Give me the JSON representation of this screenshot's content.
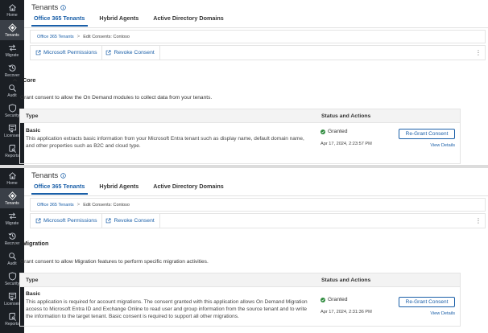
{
  "sidebar": {
    "items": [
      {
        "label": "Home",
        "icon": "home-icon"
      },
      {
        "label": "Tenants",
        "icon": "tenants-icon"
      },
      {
        "label": "Migrate",
        "icon": "migrate-icon"
      },
      {
        "label": "Recover",
        "icon": "recover-icon"
      },
      {
        "label": "Audit",
        "icon": "audit-icon"
      },
      {
        "label": "Security",
        "icon": "security-icon"
      },
      {
        "label": "Licenses",
        "icon": "licenses-icon"
      },
      {
        "label": "Reports",
        "icon": "reports-icon"
      }
    ],
    "active_item": "Tenants"
  },
  "colors": {
    "accent": "#1a5fa8",
    "sidebar_bg": "#1b1f24",
    "granted_green": "#2e8b3d"
  },
  "panels": [
    {
      "page_title": "Tenants",
      "tabs": [
        "Office 365 Tenants",
        "Hybrid Agents",
        "Active Directory Domains"
      ],
      "active_tab": "Office 365 Tenants",
      "breadcrumb": {
        "link": "Office 365 Tenants",
        "separator": ">",
        "current": "Edit Consents: Contoso"
      },
      "toolbar": {
        "permissions_label": "Microsoft Permissions",
        "revoke_label": "Revoke Consent",
        "more": "⋮"
      },
      "section": {
        "title": "Core",
        "description": "Grant consent to allow the On Demand modules to collect data from your tenants.",
        "columns": {
          "type": "Type",
          "status": "Status and Actions"
        },
        "row": {
          "name": "Basic",
          "description": "This application extracts basic information from your Microsoft Entra tenant such as display name, default domain name, and other properties such as B2C and cloud type.",
          "status": "Granted",
          "date": "Apr 17, 2024, 2:23:57 PM",
          "regrant_label": "Re-Grant Consent",
          "view_details_label": "View Details"
        }
      }
    },
    {
      "page_title": "Tenants",
      "tabs": [
        "Office 365 Tenants",
        "Hybrid Agents",
        "Active Directory Domains"
      ],
      "active_tab": "Office 365 Tenants",
      "breadcrumb": {
        "link": "Office 365 Tenants",
        "separator": ">",
        "current": "Edit Consents: Contoso"
      },
      "toolbar": {
        "permissions_label": "Microsoft Permissions",
        "revoke_label": "Revoke Consent",
        "more": "⋮"
      },
      "section": {
        "title": "Migration",
        "description": "Grant consent to allow Migration features to perform specific migration activities.",
        "columns": {
          "type": "Type",
          "status": "Status and Actions"
        },
        "row": {
          "name": "Basic",
          "description": "This application is required for account migrations. The consent granted with this application allows On Demand Migration access to Microsoft Entra ID and Exchange Online to read user and group information from the source tenant and to write the information to the target tenant. Basic consent is required to support all other migrations.",
          "status": "Granted",
          "date": "Apr 17, 2024, 2:31:36 PM",
          "regrant_label": "Re-Grant Consent",
          "view_details_label": "View Details"
        }
      }
    }
  ]
}
